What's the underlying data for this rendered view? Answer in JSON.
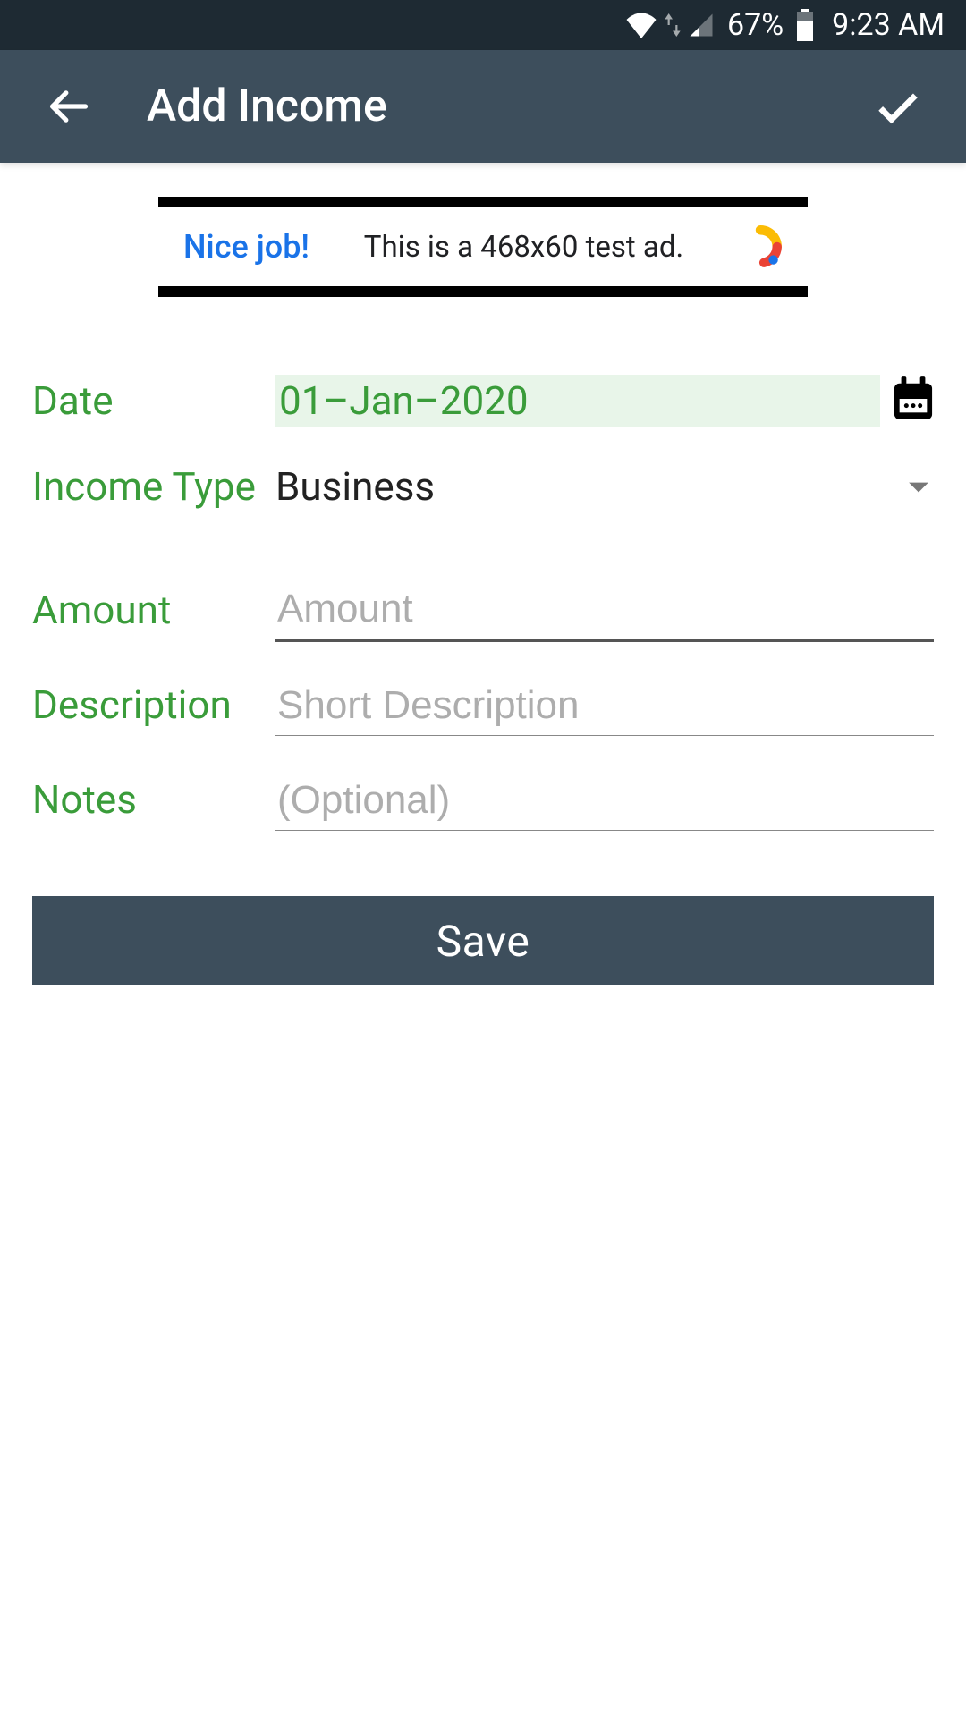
{
  "status": {
    "battery_pct": "67%",
    "time": "9:23 AM"
  },
  "header": {
    "title": "Add Income"
  },
  "ad": {
    "nice": "Nice job!",
    "text": "This is a 468x60 test ad."
  },
  "form": {
    "date_label": "Date",
    "date_value": "01–Jan–2020",
    "income_type_label": "Income Type",
    "income_type_value": "Business",
    "amount_label": "Amount",
    "amount_placeholder": "Amount",
    "description_label": "Description",
    "description_placeholder": "Short Description",
    "notes_label": "Notes",
    "notes_placeholder": "(Optional)"
  },
  "save_label": "Save"
}
